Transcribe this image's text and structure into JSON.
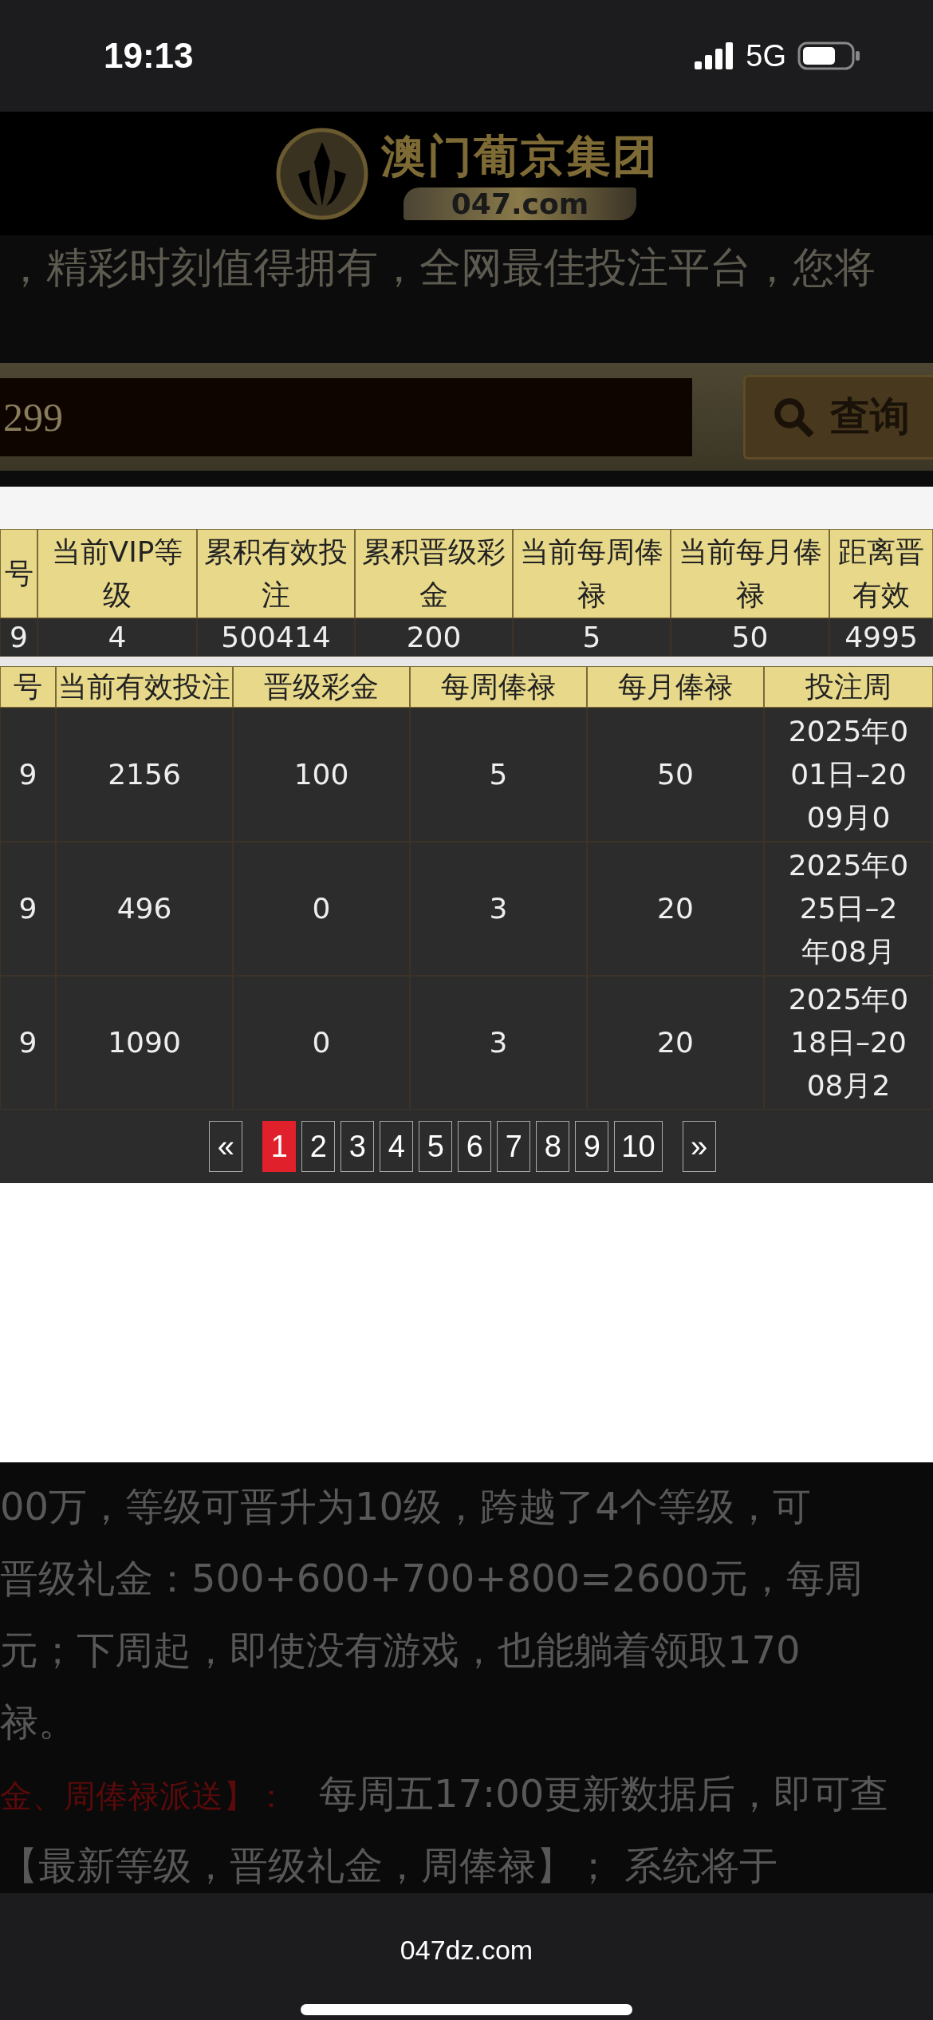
{
  "status_bar": {
    "time": "19:13",
    "network": "5G"
  },
  "header": {
    "brand": "澳门葡京集团",
    "domain": "047.com"
  },
  "marquee": "，精彩时刻值得拥有，全网最佳投注平台，您将",
  "search": {
    "value": "299",
    "button": "查询"
  },
  "summary_table": {
    "columns": [
      "号",
      "当前VIP等级",
      "累积有效投注",
      "累积晋级彩金",
      "当前每周俸禄",
      "当前每月俸禄",
      "距离晋有效"
    ],
    "rows": [
      [
        "9",
        "4",
        "500414",
        "200",
        "5",
        "50",
        "4995"
      ]
    ]
  },
  "history_table": {
    "columns": [
      "号",
      "当前有效投注",
      "晋级彩金",
      "每周俸禄",
      "每月俸禄",
      "投注周"
    ],
    "rows": [
      [
        "9",
        "2156",
        "100",
        "5",
        "50",
        "2025年0\n01日–20\n09月0"
      ],
      [
        "9",
        "496",
        "0",
        "3",
        "20",
        "2025年0\n25日–2\n年08月"
      ],
      [
        "9",
        "1090",
        "0",
        "3",
        "20",
        "2025年0\n18日–20\n08月2"
      ]
    ]
  },
  "pagination": {
    "prev": "«",
    "next": "»",
    "pages": [
      {
        "label": "1",
        "selected": true
      },
      {
        "label": "2",
        "selected": false
      },
      {
        "label": "3",
        "selected": false
      },
      {
        "label": "4",
        "selected": false
      },
      {
        "label": "5",
        "selected": false
      },
      {
        "label": "6",
        "selected": false
      },
      {
        "label": "7",
        "selected": false
      },
      {
        "label": "8",
        "selected": false
      },
      {
        "label": "9",
        "selected": false
      },
      {
        "label": "10",
        "selected": false
      }
    ]
  },
  "notes": [
    {
      "kind": "plain",
      "text": "00万，等级可晋升为10级，跨越了4个等级，可"
    },
    {
      "kind": "plain",
      "text": "晋级礼金：500+600+700+800=2600元，每周"
    },
    {
      "kind": "plain",
      "text": "元；下周起，即使没有游戏，也能躺着领取170"
    },
    {
      "kind": "plain",
      "text": "禄。"
    },
    {
      "kind": "labeled",
      "label": "金、周俸禄派送】：",
      "text": "每周五17:00更新数据后，即可查"
    },
    {
      "kind": "plain",
      "text": "【最新等级，晋级礼金，周俸禄】； 系统将于"
    }
  ],
  "browser": {
    "url": "047dz.com"
  }
}
